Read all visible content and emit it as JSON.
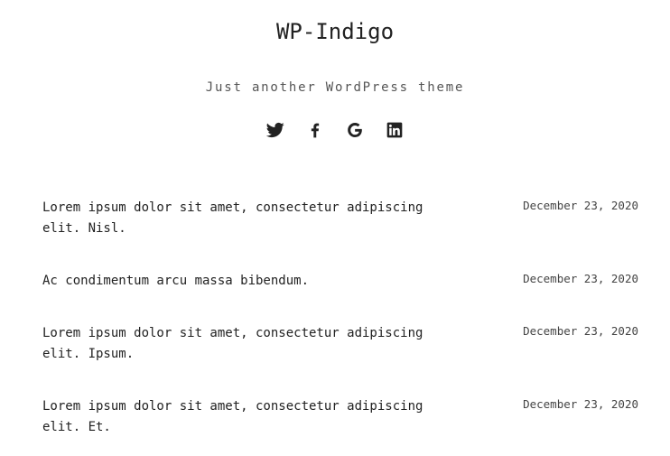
{
  "site": {
    "title": "WP-Indigo",
    "tagline": "Just another WordPress theme"
  },
  "social": [
    {
      "name": "twitter-icon",
      "color": "#222222"
    },
    {
      "name": "facebook-icon",
      "color": "#222222"
    },
    {
      "name": "google-icon",
      "color": "#222222"
    },
    {
      "name": "linkedin-icon",
      "color": "#222222"
    }
  ],
  "posts": [
    {
      "title": "Lorem ipsum dolor sit amet, consectetur adipiscing elit. Nisl.",
      "date": "December 23, 2020"
    },
    {
      "title": "Ac condimentum arcu massa bibendum.",
      "date": "December 23, 2020"
    },
    {
      "title": "Lorem ipsum dolor sit amet, consectetur adipiscing elit. Ipsum.",
      "date": "December 23, 2020"
    },
    {
      "title": "Lorem ipsum dolor sit amet, consectetur adipiscing elit. Et.",
      "date": "December 23, 2020"
    }
  ]
}
